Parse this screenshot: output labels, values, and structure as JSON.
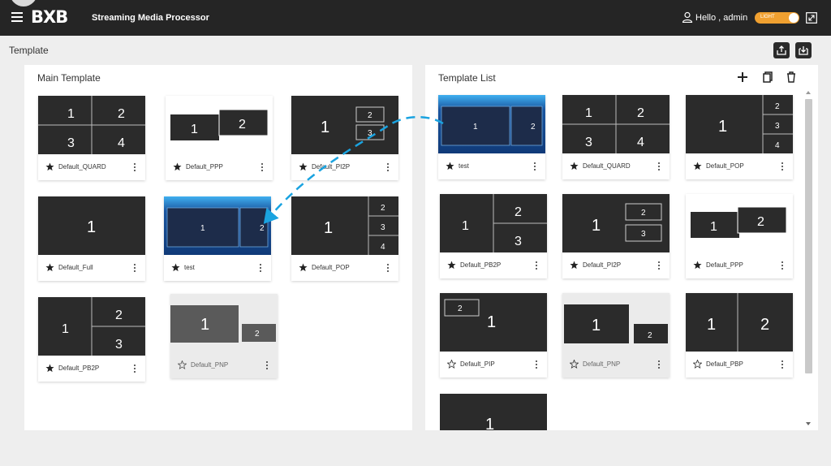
{
  "header": {
    "logo": "BXB",
    "app_title": "Streaming Media Processor",
    "greeting": "Hello , admin",
    "theme_label": "LIGHT"
  },
  "page": {
    "title": "Template"
  },
  "main_panel": {
    "title": "Main Template",
    "cards": [
      {
        "name": "Default_QUARD",
        "starred": true,
        "labels": [
          "1",
          "2",
          "3",
          "4"
        ]
      },
      {
        "name": "Default_PPP",
        "starred": true,
        "labels": [
          "1",
          "2"
        ]
      },
      {
        "name": "Default_PI2P",
        "starred": true,
        "labels": [
          "1",
          "2",
          "3"
        ]
      },
      {
        "name": "Default_Full",
        "starred": true,
        "labels": [
          "1"
        ]
      },
      {
        "name": "test",
        "starred": true,
        "labels": [
          "1",
          "2"
        ]
      },
      {
        "name": "Default_POP",
        "starred": true,
        "labels": [
          "1",
          "2",
          "3",
          "4"
        ]
      },
      {
        "name": "Default_PB2P",
        "starred": true,
        "labels": [
          "1",
          "2",
          "3"
        ]
      },
      {
        "name": "Default_PNP",
        "starred": false,
        "labels": [
          "1",
          "2"
        ]
      }
    ]
  },
  "list_panel": {
    "title": "Template List",
    "cards": [
      {
        "name": "test",
        "starred": true,
        "labels": [
          "1",
          "2"
        ]
      },
      {
        "name": "Default_QUARD",
        "starred": true,
        "labels": [
          "1",
          "2",
          "3",
          "4"
        ]
      },
      {
        "name": "Default_POP",
        "starred": true,
        "labels": [
          "1",
          "2",
          "3",
          "4"
        ]
      },
      {
        "name": "Default_PB2P",
        "starred": true,
        "labels": [
          "1",
          "2",
          "3"
        ]
      },
      {
        "name": "Default_PI2P",
        "starred": true,
        "labels": [
          "1",
          "2",
          "3"
        ]
      },
      {
        "name": "Default_PPP",
        "starred": true,
        "labels": [
          "1",
          "2"
        ]
      },
      {
        "name": "Default_PIP",
        "starred": false,
        "labels": [
          "2",
          "1"
        ]
      },
      {
        "name": "Default_PNP",
        "starred": false,
        "labels": [
          "1",
          "2"
        ]
      },
      {
        "name": "Default_PBP",
        "starred": false,
        "labels": [
          "1",
          "2"
        ]
      },
      {
        "labels": [
          "1"
        ]
      }
    ]
  },
  "icons": {
    "menu": "hamburger-icon",
    "user": "user-icon",
    "fullscreen": "expand-icon",
    "export": "export-icon",
    "import": "import-icon",
    "add": "plus-icon",
    "copy": "copy-icon",
    "delete": "trash-icon",
    "star": "star-icon",
    "more": "more-vert-icon"
  },
  "colors": {
    "topbar": "#252525",
    "toggle": "#f0a030",
    "drag_arrow": "#1aa3e0",
    "test_thumb": "#1a56a0"
  }
}
